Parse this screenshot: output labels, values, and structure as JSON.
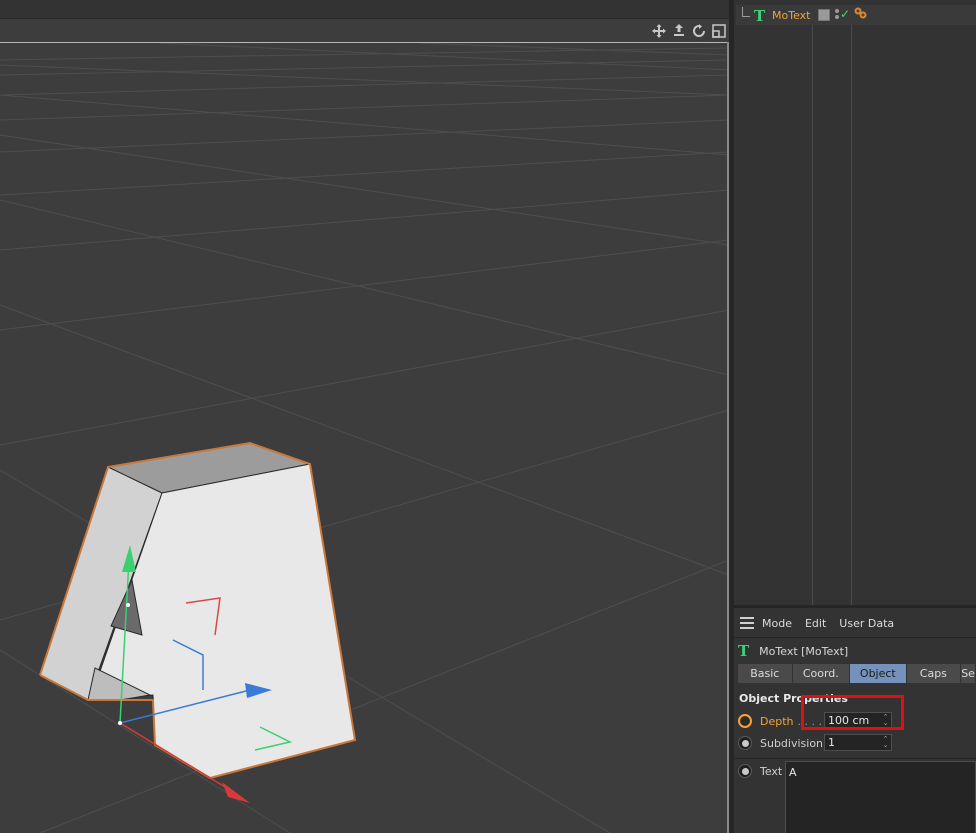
{
  "object_manager": {
    "object_name": "MoText",
    "type_icon": "T",
    "icons": [
      "layer-icon",
      "visibility-dots-icon",
      "enabled-check-icon",
      "tag-icon"
    ]
  },
  "viewport": {
    "nav_icons": [
      "move-view-icon",
      "zoom-view-icon",
      "rotate-view-icon",
      "maximize-view-icon"
    ],
    "object_letter": "A"
  },
  "attribute_manager": {
    "menu": [
      "Mode",
      "Edit",
      "User Data"
    ],
    "object_title": "MoText [MoText]",
    "tabs": [
      {
        "label": "Basic",
        "active": false
      },
      {
        "label": "Coord.",
        "active": false
      },
      {
        "label": "Object",
        "active": true
      },
      {
        "label": "Caps",
        "active": false
      },
      {
        "label": "Se",
        "active": false
      }
    ],
    "section_heading": "Object Properties",
    "depth": {
      "label": "Depth",
      "dots": ". . . .",
      "value": "100 cm"
    },
    "subdivision": {
      "label": "Subdivision",
      "value": "1"
    },
    "text": {
      "label": "Text",
      "value": "A"
    }
  },
  "colors": {
    "accent_orange": "#f0a43a",
    "active_tab": "#7592bc",
    "highlight_red": "#e01010",
    "object_icon_green": "#3fd07a"
  }
}
